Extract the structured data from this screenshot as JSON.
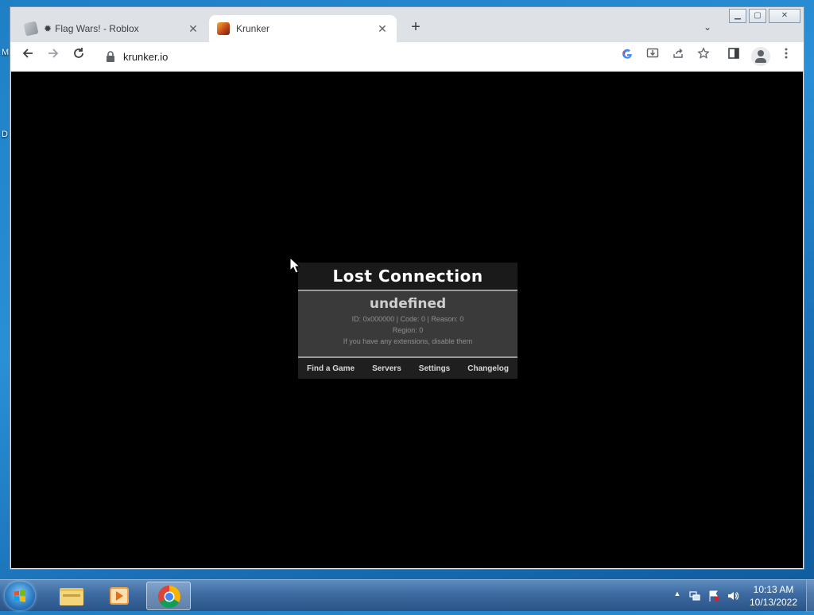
{
  "desktop": {
    "stub_top": "M",
    "stub_mid": "D"
  },
  "browser": {
    "tabs": [
      {
        "title": "Flag Wars! - Roblox",
        "prefix_icon": "gear-icon",
        "active": false
      },
      {
        "title": "Krunker",
        "active": true
      }
    ],
    "tab_close_glyph": "✕",
    "new_tab_glyph": "+",
    "tab_search_glyph": "⌄",
    "window_controls": {
      "minimize": "▁",
      "maximize": "▢",
      "close": "✕"
    },
    "url": "krunker.io"
  },
  "dialog": {
    "title": "Lost Connection",
    "subtitle": "undefined",
    "info_line": "ID: 0x000000 | Code: 0 | Reason: 0",
    "region_line": "Region: 0",
    "hint": "If you have any extensions, disable them",
    "menu": [
      "Find a Game",
      "Servers",
      "Settings",
      "Changelog"
    ]
  },
  "taskbar": {
    "clock_time": "10:13 AM",
    "clock_date": "10/13/2022",
    "tray_arrow": "▲"
  },
  "colors": {
    "accent_blue": "#1a73e8",
    "krunker_bg": "#000000",
    "dialog_bg": "#3a3a3a"
  }
}
